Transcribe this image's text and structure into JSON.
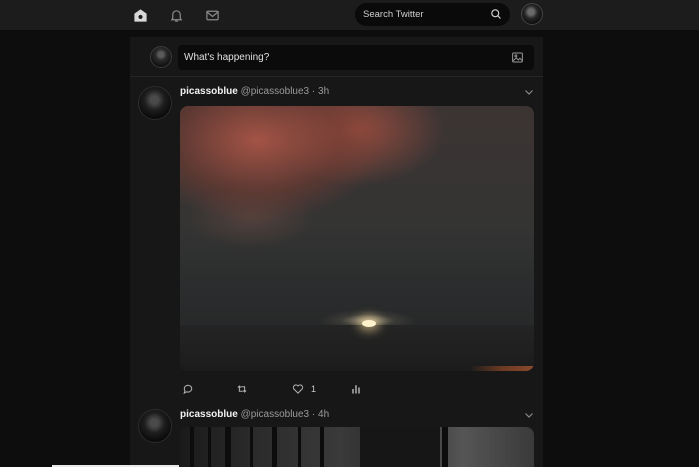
{
  "topbar": {
    "icons": [
      "home-icon",
      "notifications-icon",
      "messages-icon"
    ],
    "search_placeholder": "Search Twitter"
  },
  "composer": {
    "placeholder": "What's happening?"
  },
  "tweets": [
    {
      "name": "picassoblue",
      "handle": "@picassoblue3 · 3h",
      "likes": "1"
    },
    {
      "name": "picassoblue",
      "handle": "@picassoblue3 · 4h"
    }
  ],
  "colors": {
    "background": "#0d0d0d",
    "bar": "#1c1c1c",
    "column": "#171717"
  }
}
